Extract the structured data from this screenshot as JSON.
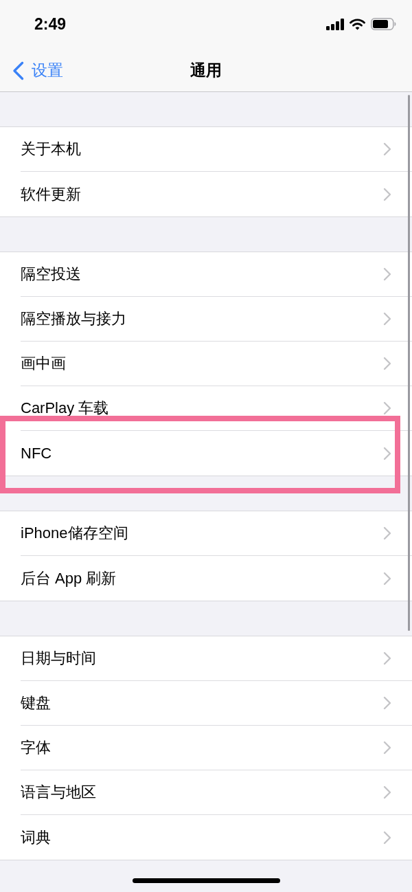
{
  "status_bar": {
    "time": "2:49"
  },
  "nav_bar": {
    "back_label": "设置",
    "title": "通用"
  },
  "groups": [
    {
      "items": [
        {
          "label": "关于本机",
          "highlighted": false
        },
        {
          "label": "软件更新",
          "highlighted": false
        }
      ]
    },
    {
      "items": [
        {
          "label": "隔空投送",
          "highlighted": false
        },
        {
          "label": "隔空播放与接力",
          "highlighted": false
        },
        {
          "label": "画中画",
          "highlighted": false
        },
        {
          "label": "CarPlay 车载",
          "highlighted": false
        },
        {
          "label": "NFC",
          "highlighted": true
        }
      ]
    },
    {
      "items": [
        {
          "label": "iPhone储存空间",
          "highlighted": false
        },
        {
          "label": "后台 App 刷新",
          "highlighted": false
        }
      ]
    },
    {
      "items": [
        {
          "label": "日期与时间",
          "highlighted": false
        },
        {
          "label": "键盘",
          "highlighted": false
        },
        {
          "label": "字体",
          "highlighted": false
        },
        {
          "label": "语言与地区",
          "highlighted": false
        },
        {
          "label": "词典",
          "highlighted": false
        }
      ]
    }
  ]
}
